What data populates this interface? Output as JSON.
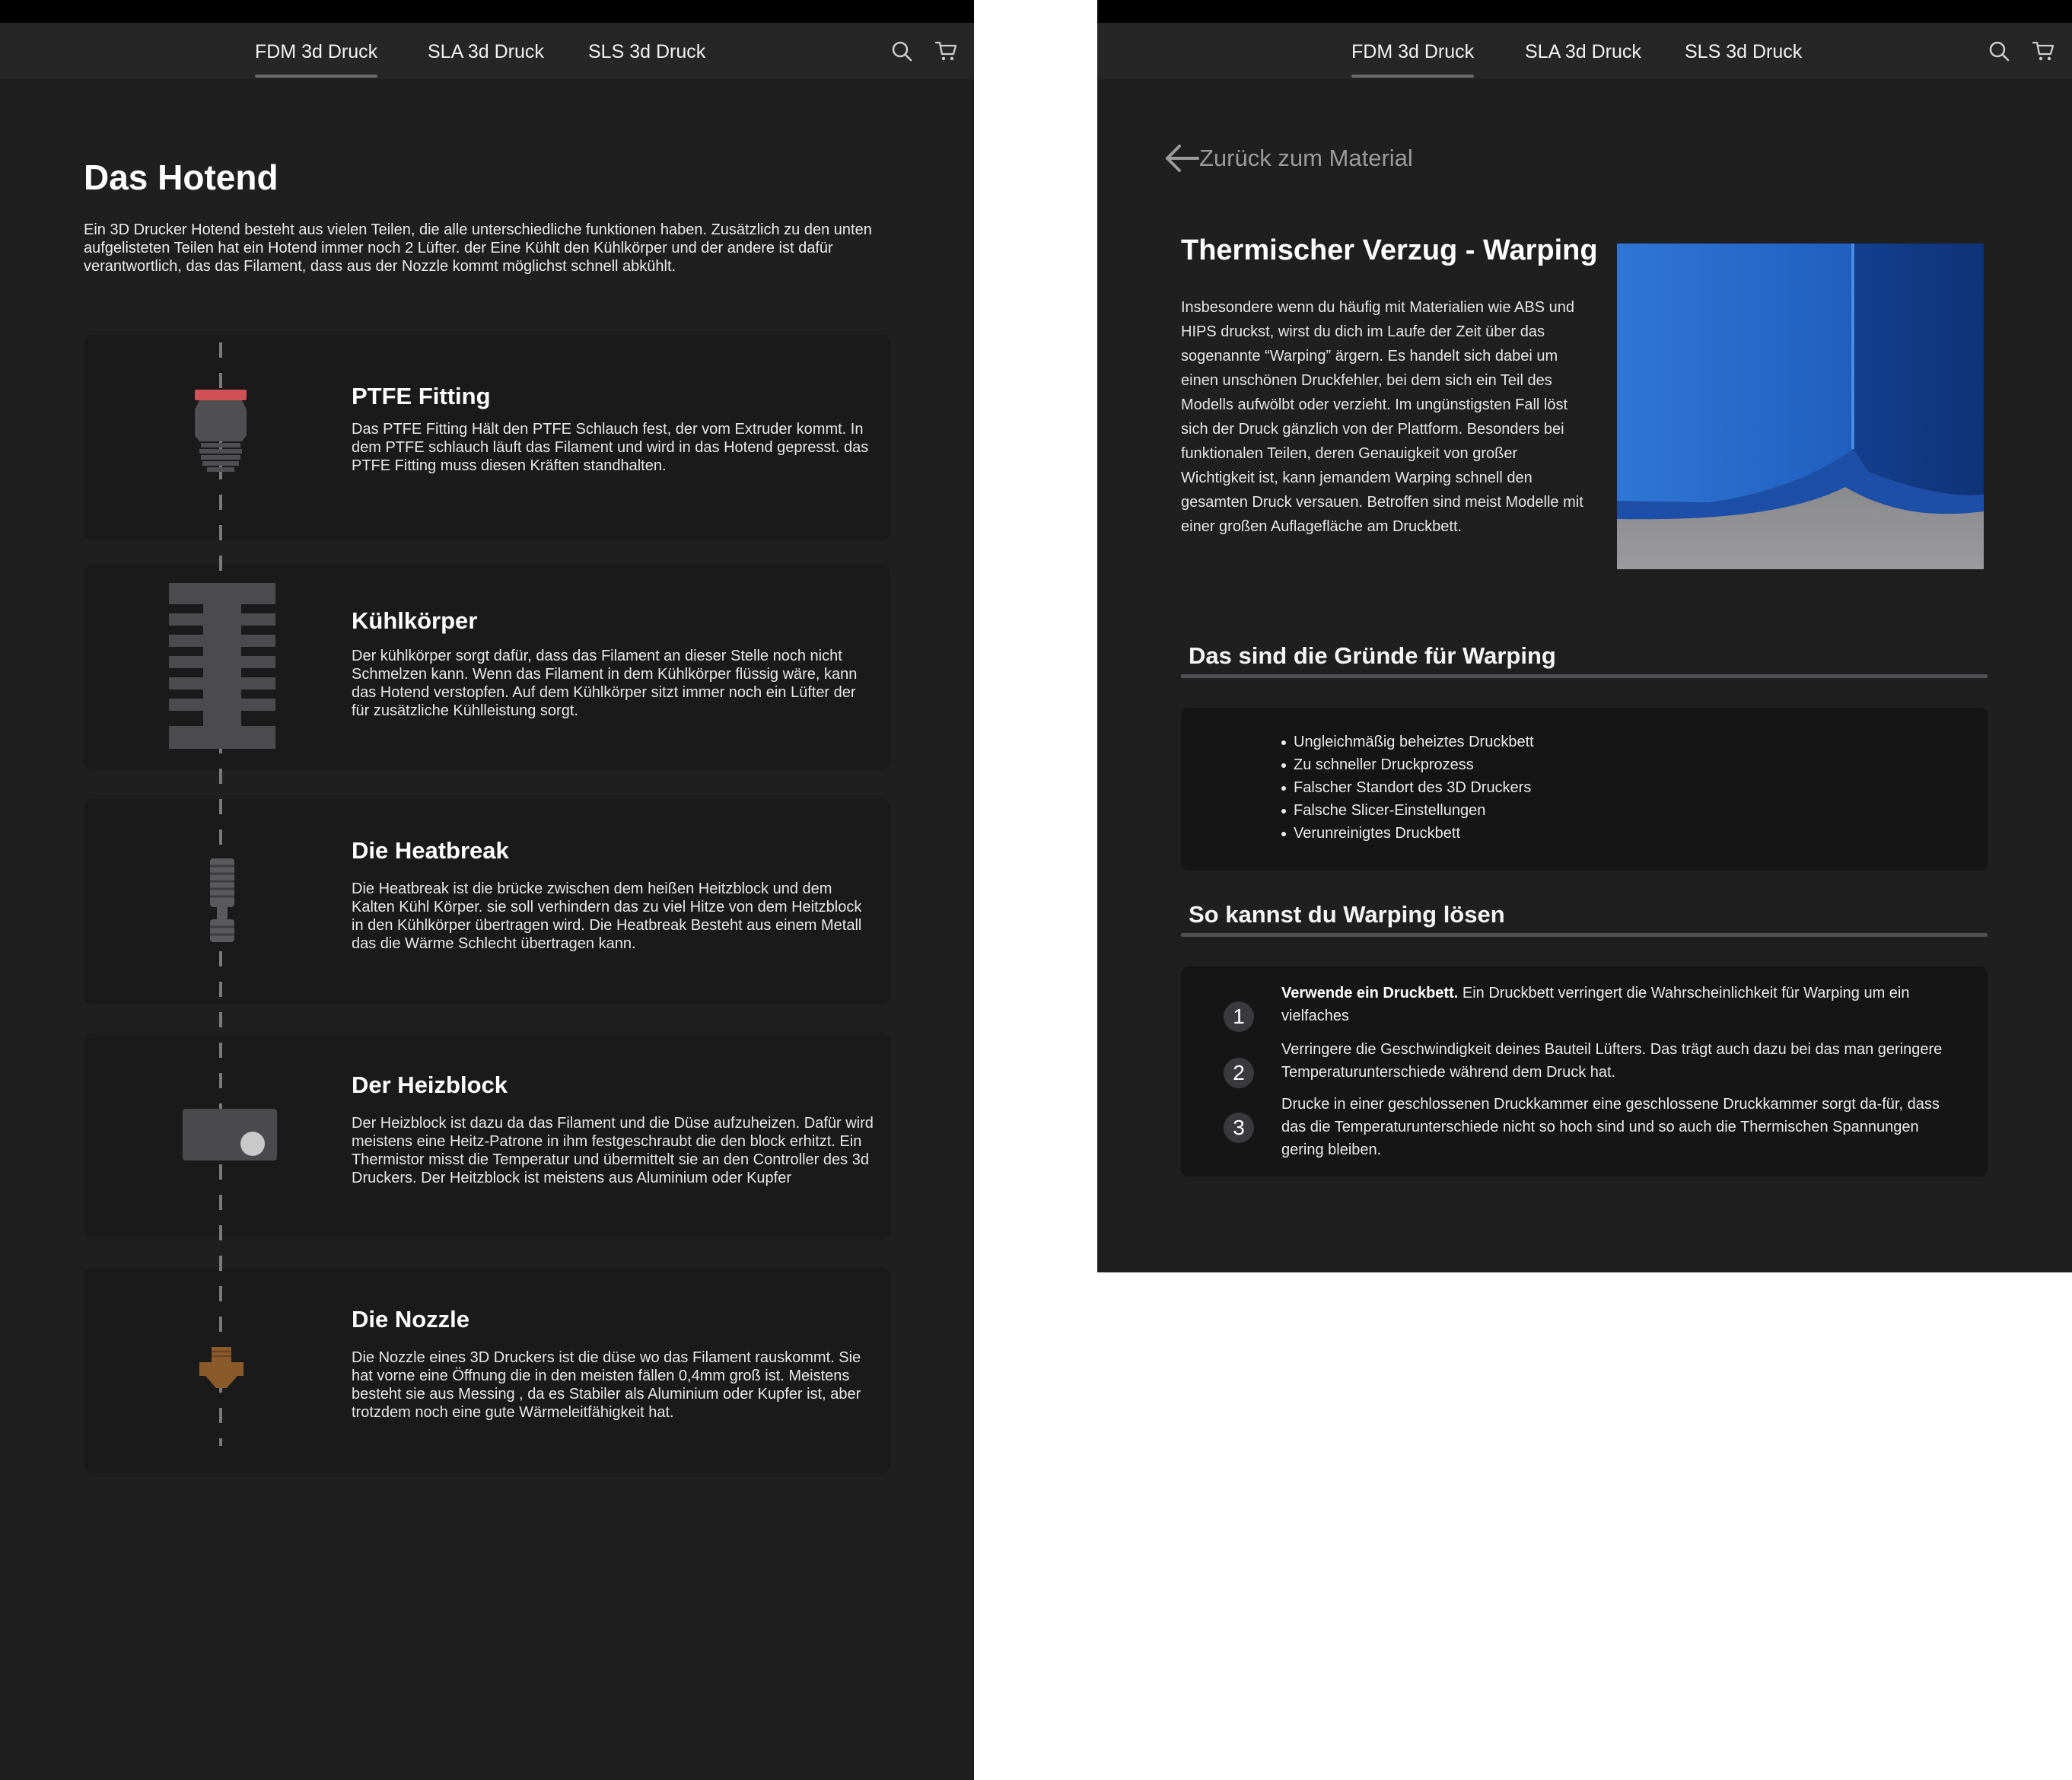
{
  "nav": {
    "tabs": [
      "FDM 3d Druck",
      "SLA 3d Druck",
      "SLS 3d Druck"
    ],
    "active_tab": "FDM 3d Druck",
    "icons": [
      "search-icon",
      "cart-icon"
    ]
  },
  "left": {
    "title": "Das Hotend",
    "intro": "Ein 3D Drucker Hotend besteht aus vielen Teilen, die alle unterschiedliche funktionen haben. Zusätzlich zu den unten aufgelisteten Teilen hat ein Hotend immer noch 2 Lüfter. der Eine Kühlt den Kühlkörper und der andere ist dafür verantwortlich, das das Filament, dass aus der Nozzle kommt möglichst schnell abkühlt.",
    "parts": [
      {
        "title": "PTFE Fitting",
        "text": "Das PTFE Fitting Hält den PTFE Schlauch fest, der vom Extruder kommt. In dem PTFE schlauch läuft das Filament und wird in das Hotend gepresst. das PTFE Fitting muss diesen Kräften standhalten.",
        "color": "#d05257"
      },
      {
        "title": "Kühlkörper",
        "text": "Der kühlkörper sorgt dafür, dass das Filament an dieser Stelle noch nicht Schmelzen kann. Wenn das Filament in dem Kühlkörper flüssig wäre, kann das Hotend verstopfen. Auf dem Kühlkörper sitzt immer noch ein Lüfter der für zusätzliche Kühlleistung sorgt.",
        "color": "#4b4b4d"
      },
      {
        "title": "Die Heatbreak",
        "text": "Die Heatbreak ist die brücke zwischen dem heißen Heitzblock und dem Kalten Kühl Körper. sie soll verhindern das zu viel Hitze von dem Heitzblock in den Kühlkörper übertragen wird. Die Heatbreak Besteht aus einem Metall das die Wärme Schlecht übertragen kann.",
        "color": "#5a5a5c"
      },
      {
        "title": "Der Heizblock",
        "text": "Der Heizblock ist dazu da das Filament und die Düse aufzuheizen. Dafür wird meistens eine Heitz-Patrone in ihm festgeschraubt die den block erhitzt. Ein Thermistor misst die Temperatur und übermittelt sie an den Controller des 3d Druckers. Der Heitzblock ist meistens aus Aluminium oder Kupfer",
        "color": "#4a4a4c"
      },
      {
        "title": "Die Nozzle",
        "text": "Die Nozzle eines 3D Druckers ist die düse wo das Filament rauskommt. Sie hat vorne eine Öffnung die in den meisten fällen 0,4mm groß ist. Meistens besteht sie aus Messing , da es Stabiler als Aluminium oder Kupfer ist, aber trotzdem noch eine gute Wärmeleitfähigkeit hat.",
        "color": "#8a5a2b"
      }
    ]
  },
  "right": {
    "back_label": "Zurück zum Material",
    "title": "Thermischer Verzug - Warping",
    "text": "Insbesondere wenn du häufig mit Materialien wie ABS und HIPS druckst, wirst du dich im Laufe der Zeit über das sogenannte “Warping” ärgern. Es handelt sich dabei um einen unschönen Druckfehler, bei dem sich ein Teil des Modells aufwölbt oder verzieht. Im ungünstigsten Fall löst sich der Druck gänzlich von der Plattform. Besonders bei funktionalen Teilen, deren Genauigkeit von großer Wichtigkeit ist, kann jemandem Warping schnell den gesamten Druck versauen. Betroffen sind meist Modelle mit einer großen Auflagefläche am Druckbett.",
    "reasons_title": "Das sind die Gründe für Warping",
    "reasons": [
      "Ungleichmäßig beheiztes Druckbett",
      "Zu schneller Druckprozess",
      "Falscher Standort des 3D Druckers",
      "Falsche Slicer-Einstellungen",
      "Verunreinigtes Druckbett"
    ],
    "solutions_title": "So kannst du Warping lösen",
    "solutions": [
      {
        "num": "1",
        "bold": "Verwende ein Druckbett.",
        "text": " Ein Druckbett verringert die Wahrscheinlichkeit für Warping um ein vielfaches"
      },
      {
        "num": "2",
        "bold": "",
        "text": "Verringere die Geschwindigkeit deines Bauteil Lüfters. Das trägt auch dazu bei das man geringere Temperaturunterschiede während dem Druck hat."
      },
      {
        "num": "3",
        "bold": "",
        "text": "Drucke in einer geschlossenen Druckkammer eine geschlossene Druckkammer sorgt da-für, dass das die Temperaturunterschiede nicht so hoch sind und so auch die Thermischen Spannungen gering bleiben."
      }
    ],
    "photo_color": "#2a6fd0"
  }
}
